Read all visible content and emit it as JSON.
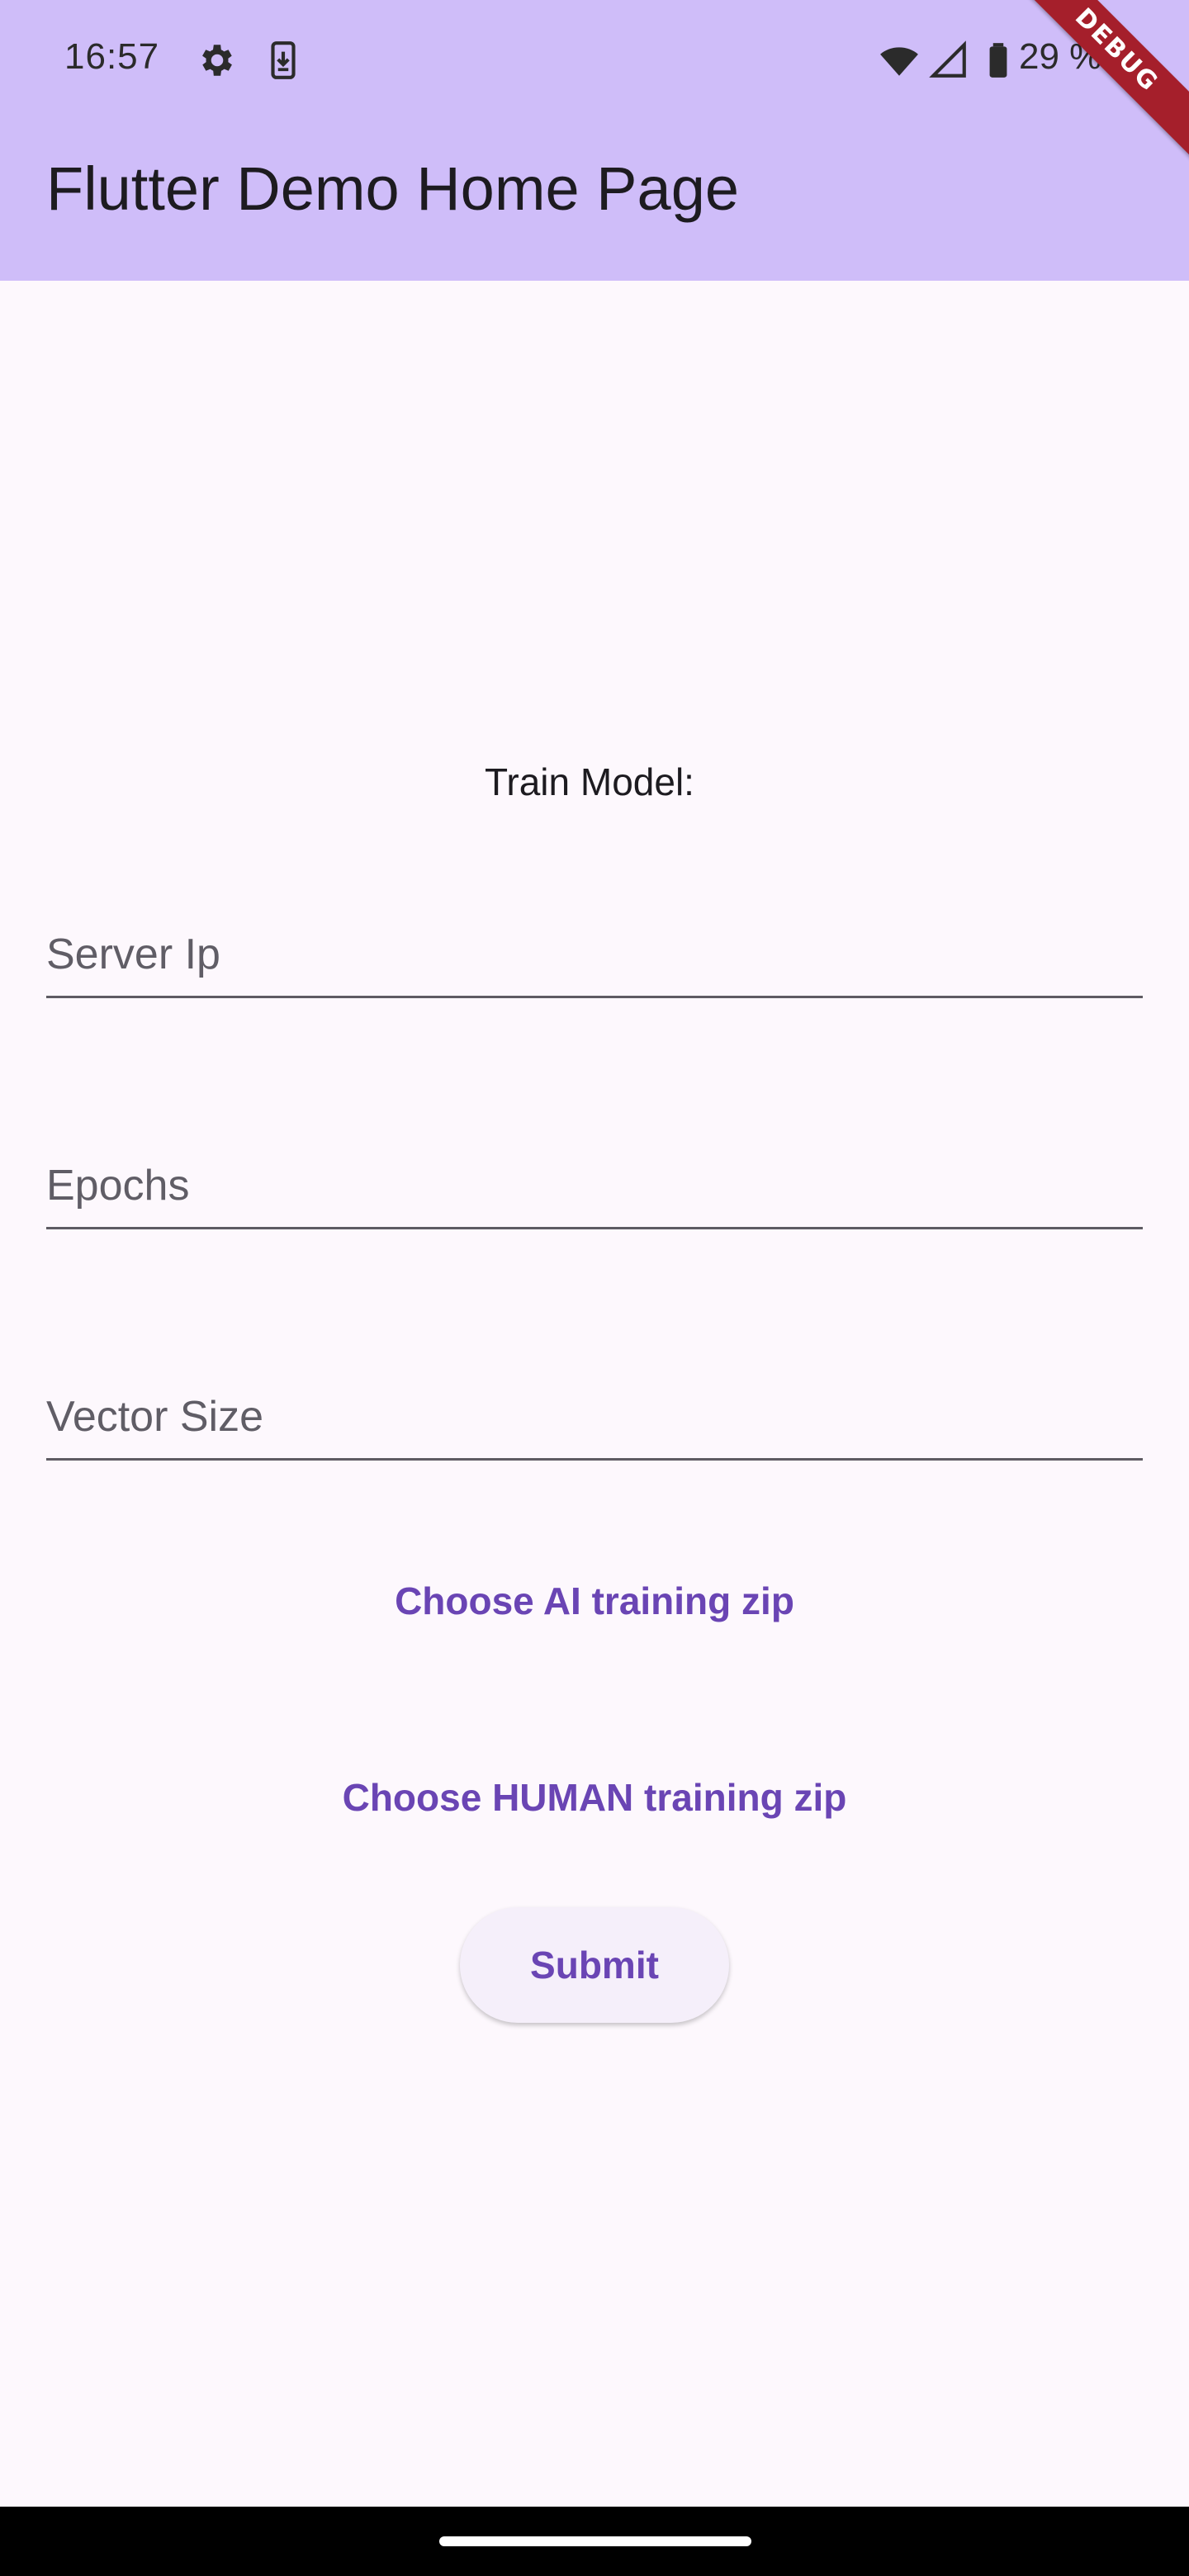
{
  "status_bar": {
    "time": "16:57",
    "battery_text": "29 %",
    "icons": [
      "settings-icon",
      "download-icon",
      "wifi-icon",
      "cell-signal-icon",
      "battery-icon"
    ]
  },
  "app_bar": {
    "title": "Flutter Demo Home Page",
    "color": "#cfbdf9"
  },
  "debug_banner": {
    "label": "DEBUG",
    "color": "#a51f2b"
  },
  "form": {
    "heading": "Train Model:",
    "server_ip_placeholder": "Server Ip",
    "epochs_placeholder": "Epochs",
    "vector_size_placeholder": "Vector Size",
    "choose_ai_label": "Choose AI training zip",
    "choose_human_label": "Choose HUMAN training zip",
    "submit_label": "Submit",
    "accent_color": "#6a45b4"
  }
}
